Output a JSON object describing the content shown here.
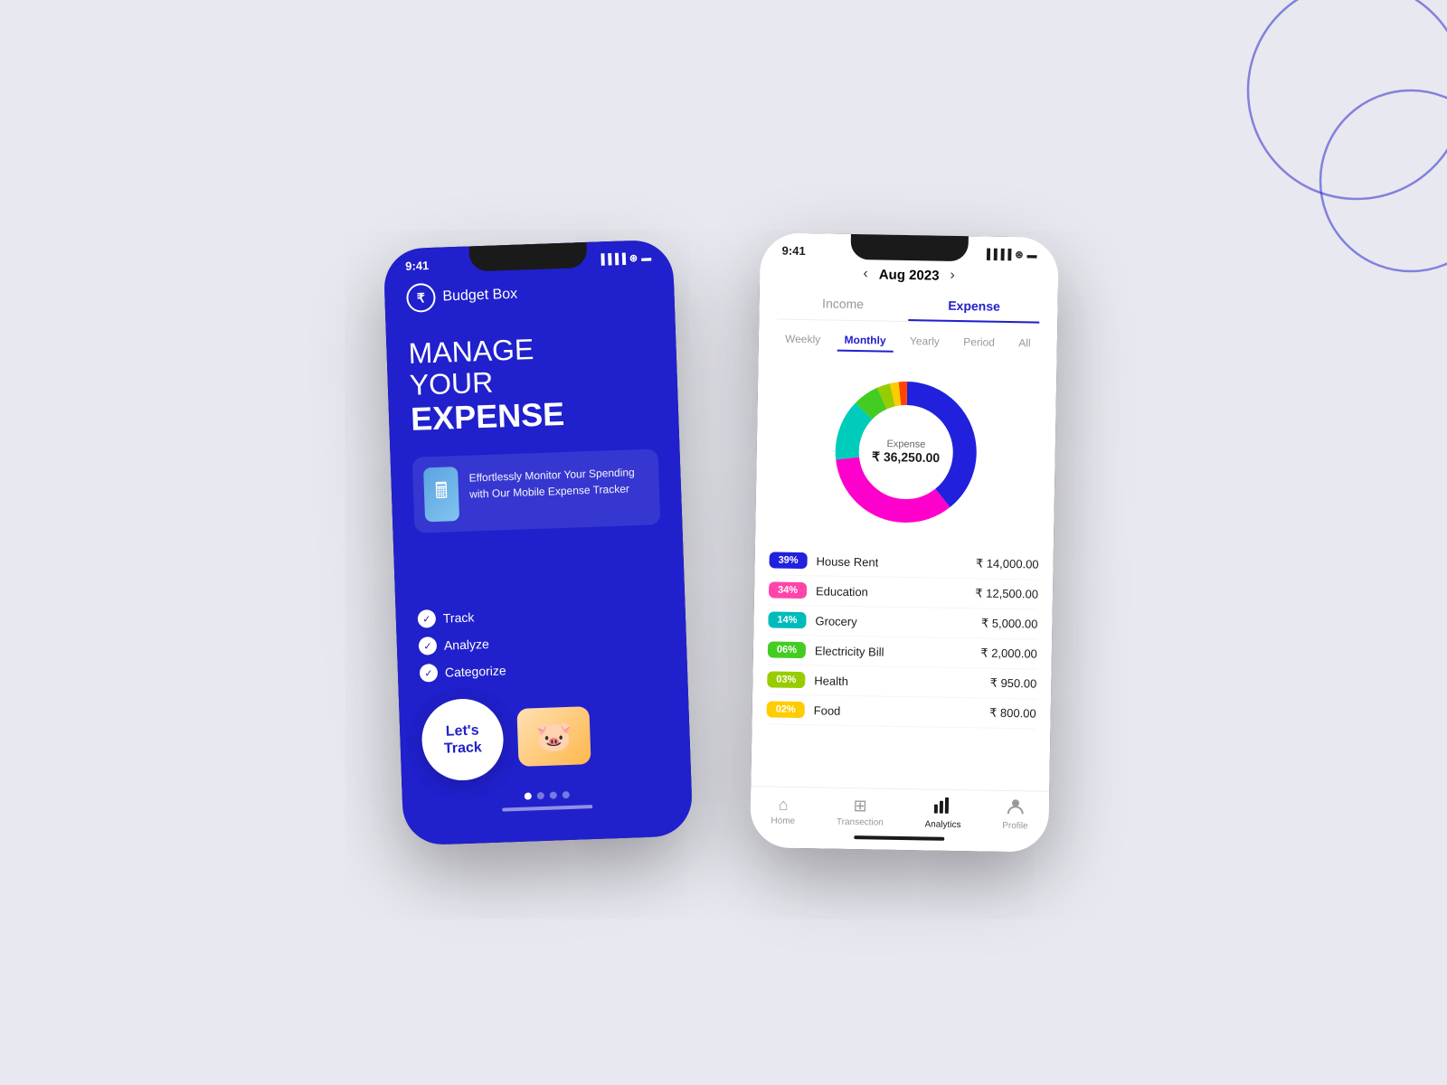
{
  "background": {
    "color": "#e8e8f0"
  },
  "phone1": {
    "status": {
      "time": "9:41"
    },
    "header": {
      "app_name": "Budget Box",
      "rupee_symbol": "₹"
    },
    "hero": {
      "line1": "MANAGE",
      "line2": "YOUR",
      "line3": "EXPENSE"
    },
    "feature_card": {
      "text": "Effortlessly Monitor Your Spending with Our Mobile Expense Tracker"
    },
    "checklist": [
      {
        "label": "Track"
      },
      {
        "label": "Analyze"
      },
      {
        "label": "Categorize"
      }
    ],
    "cta": {
      "label_line1": "Let's",
      "label_line2": "Track"
    },
    "dots": [
      true,
      false,
      false,
      false
    ]
  },
  "phone2": {
    "status": {
      "time": "9:41"
    },
    "month_nav": {
      "prev": "‹",
      "label": "Aug 2023",
      "next": "›"
    },
    "tabs_ie": [
      {
        "label": "Income",
        "active": false
      },
      {
        "label": "Expense",
        "active": true
      }
    ],
    "period_tabs": [
      {
        "label": "Weekly",
        "active": false
      },
      {
        "label": "Monthly",
        "active": true
      },
      {
        "label": "Yearly",
        "active": false
      },
      {
        "label": "Period",
        "active": false
      },
      {
        "label": "All",
        "active": false
      }
    ],
    "donut": {
      "label": "Expense",
      "value": "₹ 36,250.00",
      "segments": [
        {
          "color": "#2828e8",
          "percent": 39,
          "start": 0,
          "end": 140
        },
        {
          "color": "#ff00cc",
          "percent": 34,
          "start": 140,
          "end": 262
        },
        {
          "color": "#00cccc",
          "percent": 14,
          "start": 262,
          "end": 312
        },
        {
          "color": "#00cc44",
          "percent": 6,
          "start": 312,
          "end": 334
        },
        {
          "color": "#aacc00",
          "percent": 3,
          "start": 334,
          "end": 345
        },
        {
          "color": "#ffcc00",
          "percent": 2,
          "start": 345,
          "end": 352
        },
        {
          "color": "#ff4400",
          "percent": 2,
          "start": 352,
          "end": 360
        }
      ]
    },
    "expenses": [
      {
        "badge_color": "#2828e8",
        "percent": "39%",
        "name": "House Rent",
        "amount": "₹ 14,000.00"
      },
      {
        "badge_color": "#ff44aa",
        "percent": "34%",
        "name": "Education",
        "amount": "₹ 12,500.00"
      },
      {
        "badge_color": "#00bbbb",
        "percent": "14%",
        "name": "Grocery",
        "amount": "₹ 5,000.00"
      },
      {
        "badge_color": "#44cc22",
        "percent": "06%",
        "name": "Electricity Bill",
        "amount": "₹ 2,000.00"
      },
      {
        "badge_color": "#99cc00",
        "percent": "03%",
        "name": "Health",
        "amount": "₹ 950.00"
      },
      {
        "badge_color": "#ffcc00",
        "percent": "02%",
        "name": "Food",
        "amount": "₹ 800.00"
      }
    ],
    "bottom_nav": [
      {
        "label": "Home",
        "icon": "⌂",
        "active": false
      },
      {
        "label": "Transection",
        "icon": "⊞",
        "active": false
      },
      {
        "label": "Analytics",
        "icon": "📊",
        "active": true
      },
      {
        "label": "Profile",
        "icon": "👤",
        "active": false
      }
    ]
  }
}
